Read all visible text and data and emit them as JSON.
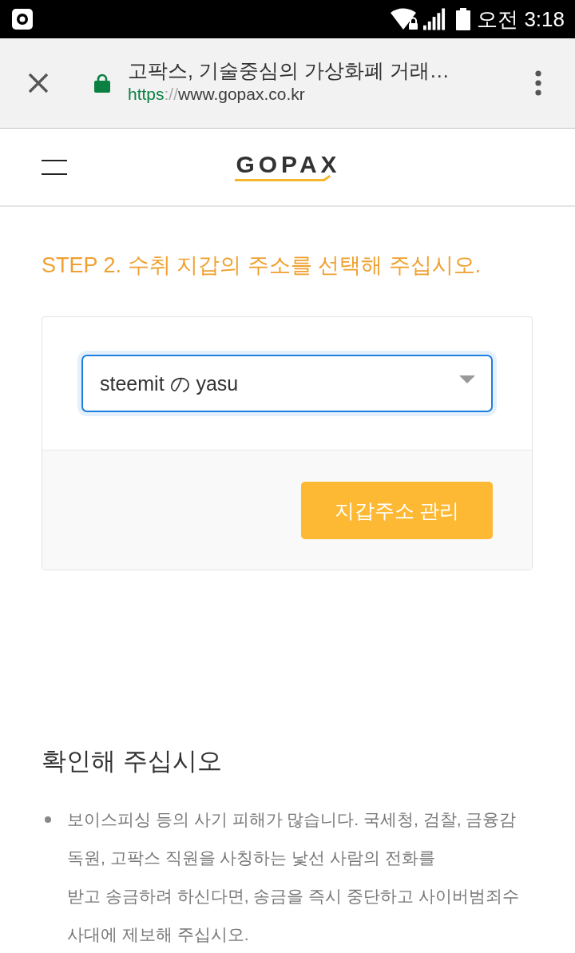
{
  "status_bar": {
    "time": "오전 3:18"
  },
  "browser_toolbar": {
    "secure": true,
    "page_title": "고팍스, 기술중심의 가상화폐 거래…",
    "url": {
      "scheme": "https",
      "separator": "://",
      "host": "www.gopax.co.kr"
    }
  },
  "site_header": {
    "logo": "GOPAX"
  },
  "step_heading": "STEP 2. 수취 지갑의 주소를 선택해 주십시오.",
  "wallet_card": {
    "select": {
      "value": "steemit の yasu",
      "focused": true
    },
    "button": "지갑주소 관리"
  },
  "notice": {
    "title": "확인해 주십시오",
    "items": [
      "보이스피싱 등의 사기 피해가 많습니다. 국세청, 검찰, 금융감독원, 고팍스 직원을 사칭하는 낯선 사람의 전화를\n받고 송금하려 하신다면, 송금을 즉시 중단하고 사이버범죄수사대에 제보해 주십시오."
    ]
  }
}
